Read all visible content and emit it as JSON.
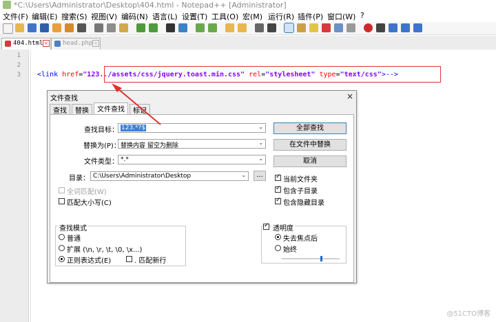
{
  "window": {
    "title": "*C:\\Users\\Administrator\\Desktop\\404.html - Notepad++ [Administrator]"
  },
  "menu": [
    "文件(F)",
    "编辑(E)",
    "搜索(S)",
    "视图(V)",
    "编码(N)",
    "语言(L)",
    "设置(T)",
    "工具(O)",
    "宏(M)",
    "运行(R)",
    "插件(P)",
    "窗口(W)",
    "?"
  ],
  "tabs": [
    {
      "label": "404.html"
    },
    {
      "label": "head.php"
    }
  ],
  "editor": {
    "lines": [
      "1",
      "2",
      "3"
    ],
    "code": {
      "lt": "<",
      "tag": "link",
      "attr1": "href",
      "eq1": "=",
      "val1": "\"123../assets/css/jquery.toast.min.css\"",
      "attr2": "rel",
      "eq2": "=",
      "val2": "\"stylesheet\"",
      "attr3": "type",
      "eq3": "=",
      "val3": "\"text/css\"",
      "end": ">-->"
    }
  },
  "dialog": {
    "title": "文件查找",
    "close": "×",
    "tabs": [
      "查找",
      "替换",
      "文件查找",
      "标记"
    ],
    "find_label": "查找目标：",
    "find_value": "123.*?$",
    "replace_label": "替换为(P)：",
    "replace_value": "替换内容  留空为删除",
    "filter_label": "文件类型：",
    "filter_value": "*.*",
    "dir_label": "目录：",
    "dir_value": "C:\\Users\\Administrator\\Desktop",
    "browse_label": "...",
    "buttons": {
      "find_all": "全部查找",
      "replace_in_files": "在文件中替换",
      "cancel": "取消"
    },
    "options": {
      "whole_word": "全词匹配(W)",
      "match_case": "匹配大小写(C)",
      "current_folder": "当前文件夹",
      "sub_folders": "包含子目录",
      "hidden_folders": "包含隐藏目录"
    },
    "search_mode": {
      "title": "查找模式",
      "normal": "普通",
      "extended": "扩展 (\\n, \\r, \\t, \\0, \\x...)",
      "regex": "正则表达式(E)",
      "dot_newline": ". 匹配新行"
    },
    "transparency": {
      "title": "透明度",
      "on_lose_focus": "失去焦点后",
      "always": "始终",
      "level": 0.67
    }
  },
  "watermark": "@51CTO博客",
  "colors": {
    "annotation": "#e03131",
    "tag": "#0000ff",
    "attr": "#ff0000",
    "value": "#8000ff"
  }
}
